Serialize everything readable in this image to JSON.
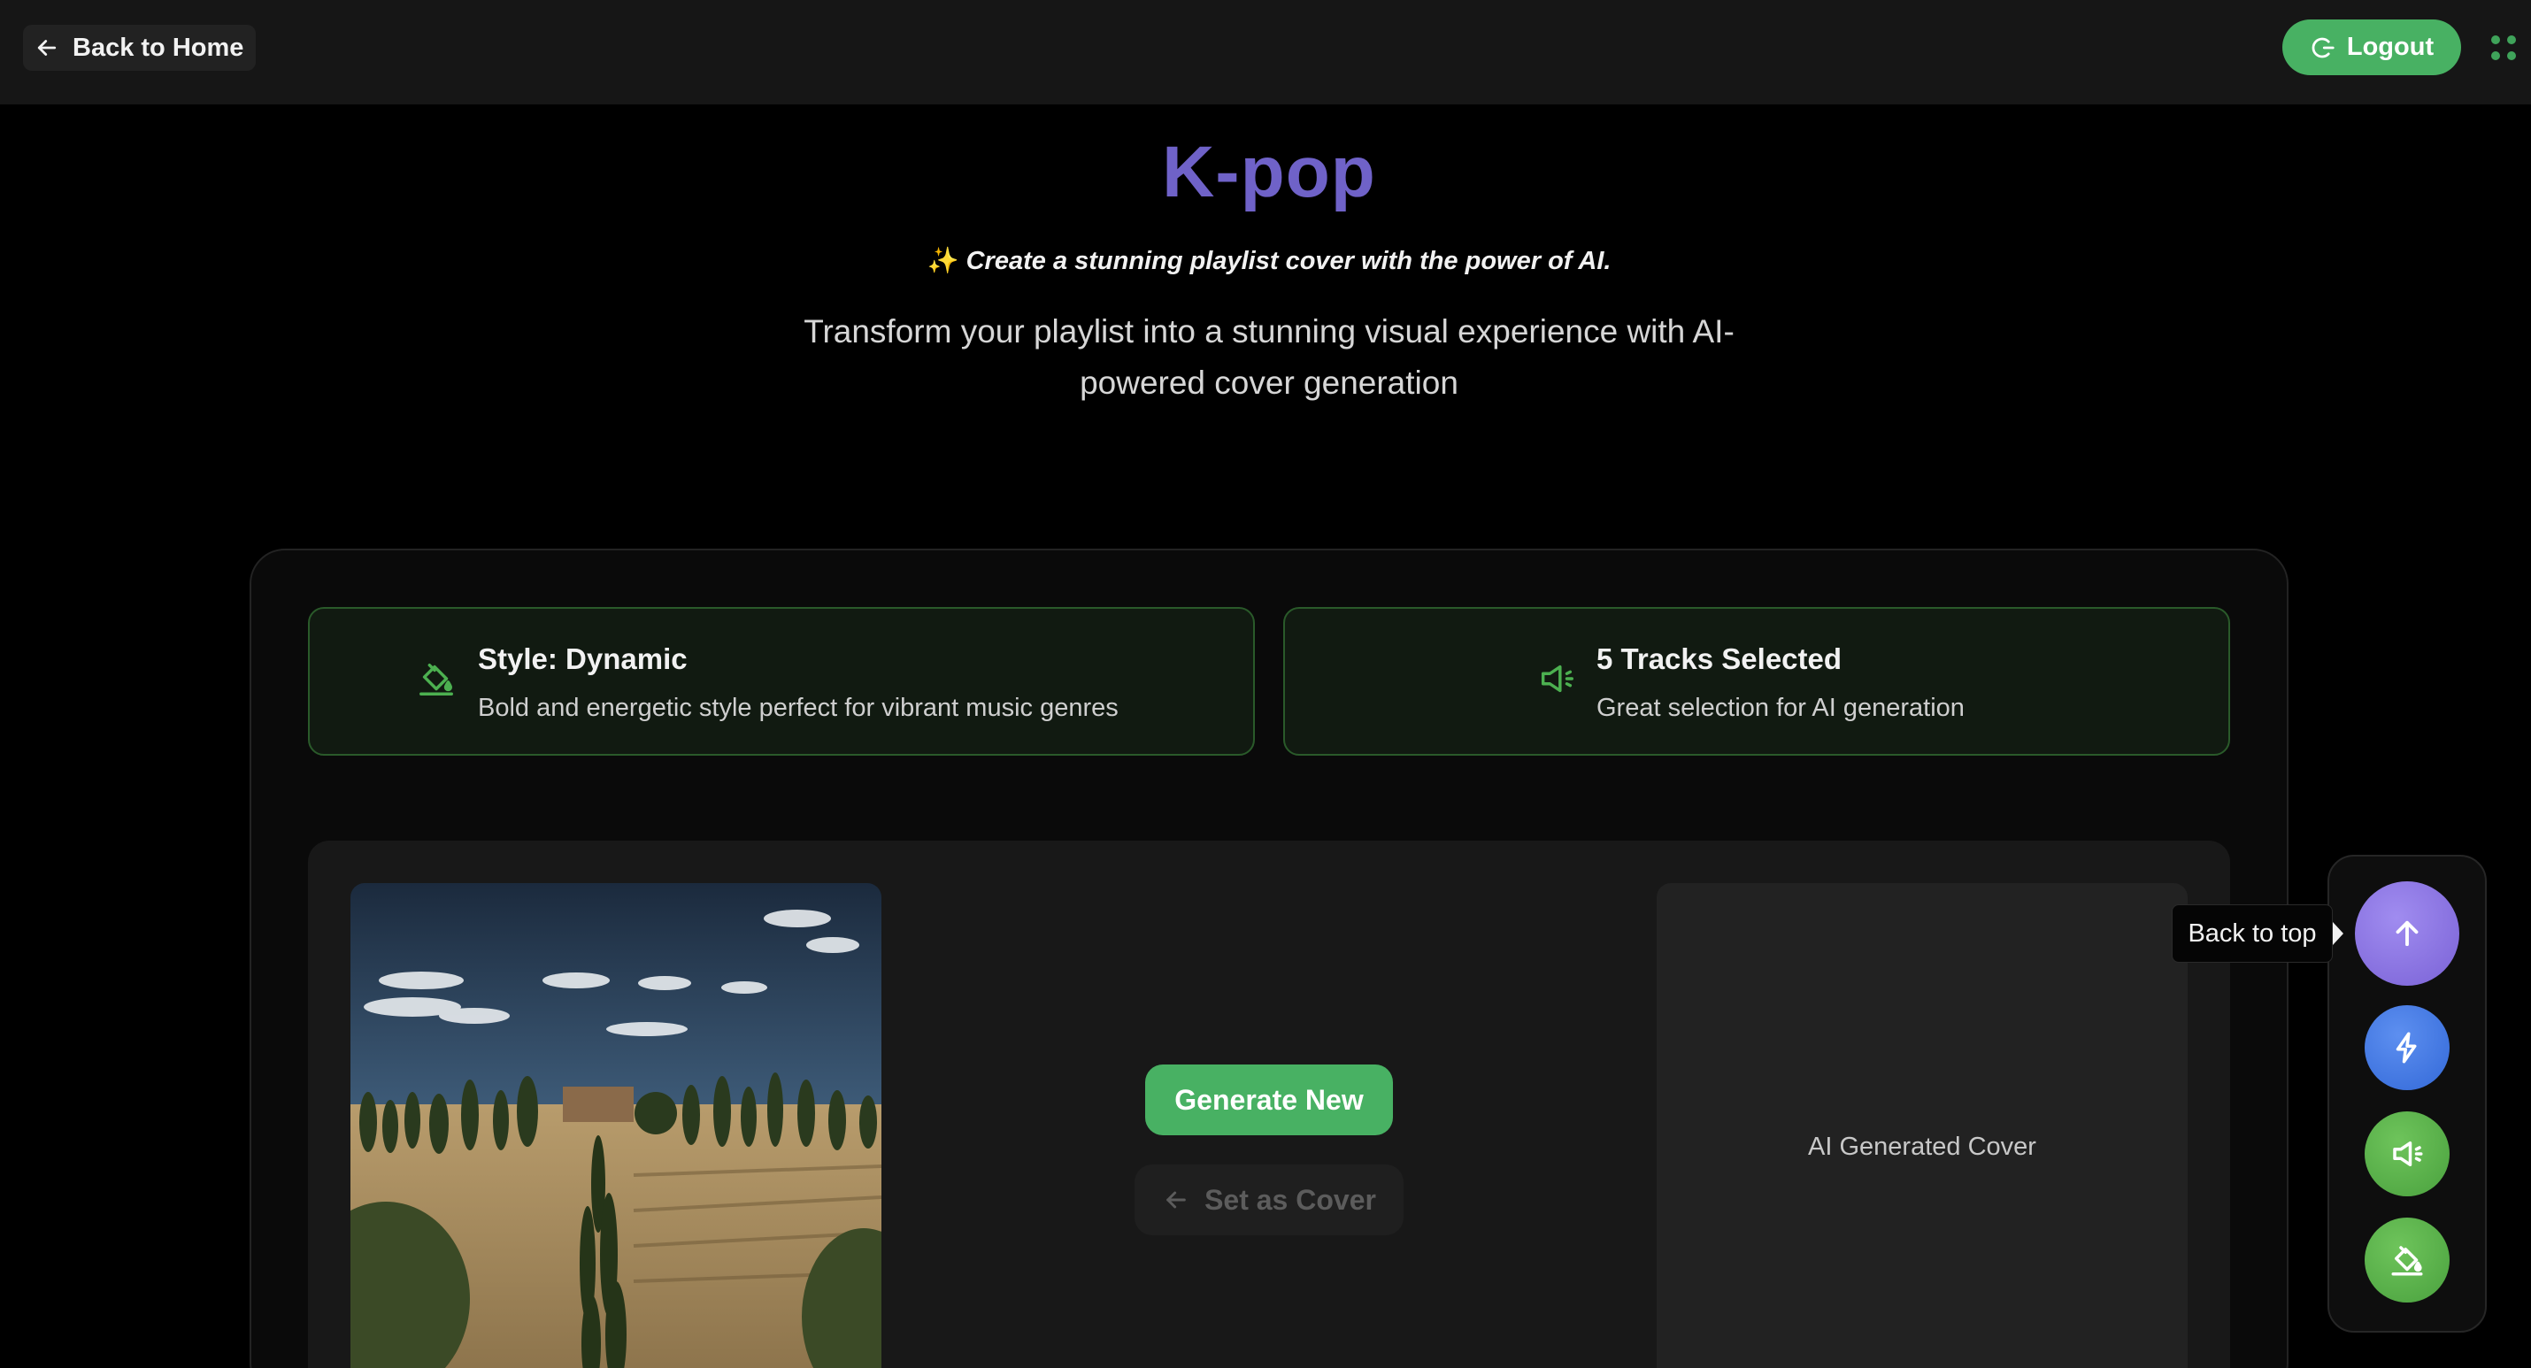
{
  "header": {
    "back_label": "Back to Home",
    "logout_label": "Logout"
  },
  "hero": {
    "title": "K-pop",
    "tagline_icon": "✨",
    "tagline": "Create a stunning playlist cover with the power of AI.",
    "subtitle": "Transform your playlist into a stunning visual experience with AI-powered cover generation"
  },
  "cards": {
    "style": {
      "title": "Style: Dynamic",
      "description": "Bold and energetic style perfect for vibrant music genres",
      "icon": "paint-bucket-icon"
    },
    "tracks": {
      "title": "5 Tracks Selected",
      "description": "Great selection for AI generation",
      "icon": "speaker-icon"
    }
  },
  "actions": {
    "generate_label": "Generate New",
    "set_cover_label": "Set as Cover"
  },
  "ai_cover": {
    "placeholder": "AI Generated Cover"
  },
  "dock": {
    "tooltip": "Back to top",
    "buttons": [
      "arrow-up-icon",
      "flash-icon",
      "speaker-icon",
      "paint-bucket-icon"
    ]
  },
  "colors": {
    "accent_green": "#48b163",
    "title_purple": "#6f62c8",
    "card_border_green": "#2a5a2a",
    "fab_purple": "#8a72e0",
    "fab_blue": "#3f78e0"
  }
}
